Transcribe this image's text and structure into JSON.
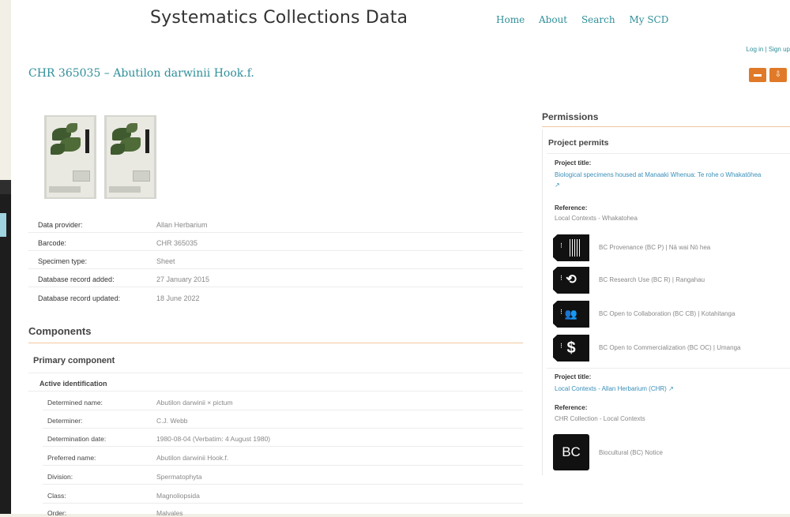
{
  "header": {
    "site_title": "Systematics Collections Data",
    "nav": [
      "Home",
      "About",
      "Search",
      "My SCD"
    ],
    "auth": "Log in | Sign up"
  },
  "record": {
    "title": "CHR 365035 – Abutilon darwinii Hook.f.",
    "actions": [
      "folder-icon",
      "download-icon"
    ]
  },
  "details": [
    {
      "label": "Data provider:",
      "value": "Allan Herbarium"
    },
    {
      "label": "Barcode:",
      "value": "CHR 365035"
    },
    {
      "label": "Specimen type:",
      "value": "Sheet"
    },
    {
      "label": "Database record added:",
      "value": "27 January 2015"
    },
    {
      "label": "Database record updated:",
      "value": "18 June 2022"
    }
  ],
  "components": {
    "heading": "Components",
    "primary": "Primary component",
    "active_identification": "Active identification",
    "rows": [
      {
        "label": "Determined name:",
        "value": "Abutilon darwinii × pictum"
      },
      {
        "label": "Determiner:",
        "value": "C.J. Webb"
      },
      {
        "label": "Determination date:",
        "value": "1980-08-04 (Verbatim: 4 August 1980)"
      },
      {
        "label": "Preferred name:",
        "value": "Abutilon darwinii Hook.f."
      },
      {
        "label": "Division:",
        "value": "Spermatophyta"
      },
      {
        "label": "Class:",
        "value": "Magnoliopsida"
      },
      {
        "label": "Order:",
        "value": "Malvales"
      }
    ]
  },
  "permissions": {
    "heading": "Permissions",
    "project_permits": "Project permits",
    "project_title_label": "Project title:",
    "project1_title": "Biological specimens housed at Manaaki Whenua: Te rohe o Whakatōhea",
    "reference_label": "Reference:",
    "project1_reference": "Local Contexts - Whakatohea",
    "labels": [
      {
        "icon": "bc-provenance-icon",
        "glyph": "",
        "text": "BC Provenance (BC P) | Nā wai Nō hea"
      },
      {
        "icon": "bc-research-use-icon",
        "glyph": "⟲",
        "text": "BC Research Use (BC R) | Rangahau"
      },
      {
        "icon": "bc-open-collaboration-icon",
        "glyph": "👥",
        "text": "BC Open to Collaboration (BC CB) | Kotahitanga"
      },
      {
        "icon": "bc-open-commercialization-icon",
        "glyph": "$",
        "text": "BC Open to Commercialization (BC OC) | Umanga"
      }
    ],
    "project2_title": "Local Contexts - Allan Herbarium (CHR)",
    "project2_reference": "CHR Collection - Local Contexts",
    "notice_glyph": "BC",
    "notice_text": "Biocultural (BC) Notice"
  }
}
